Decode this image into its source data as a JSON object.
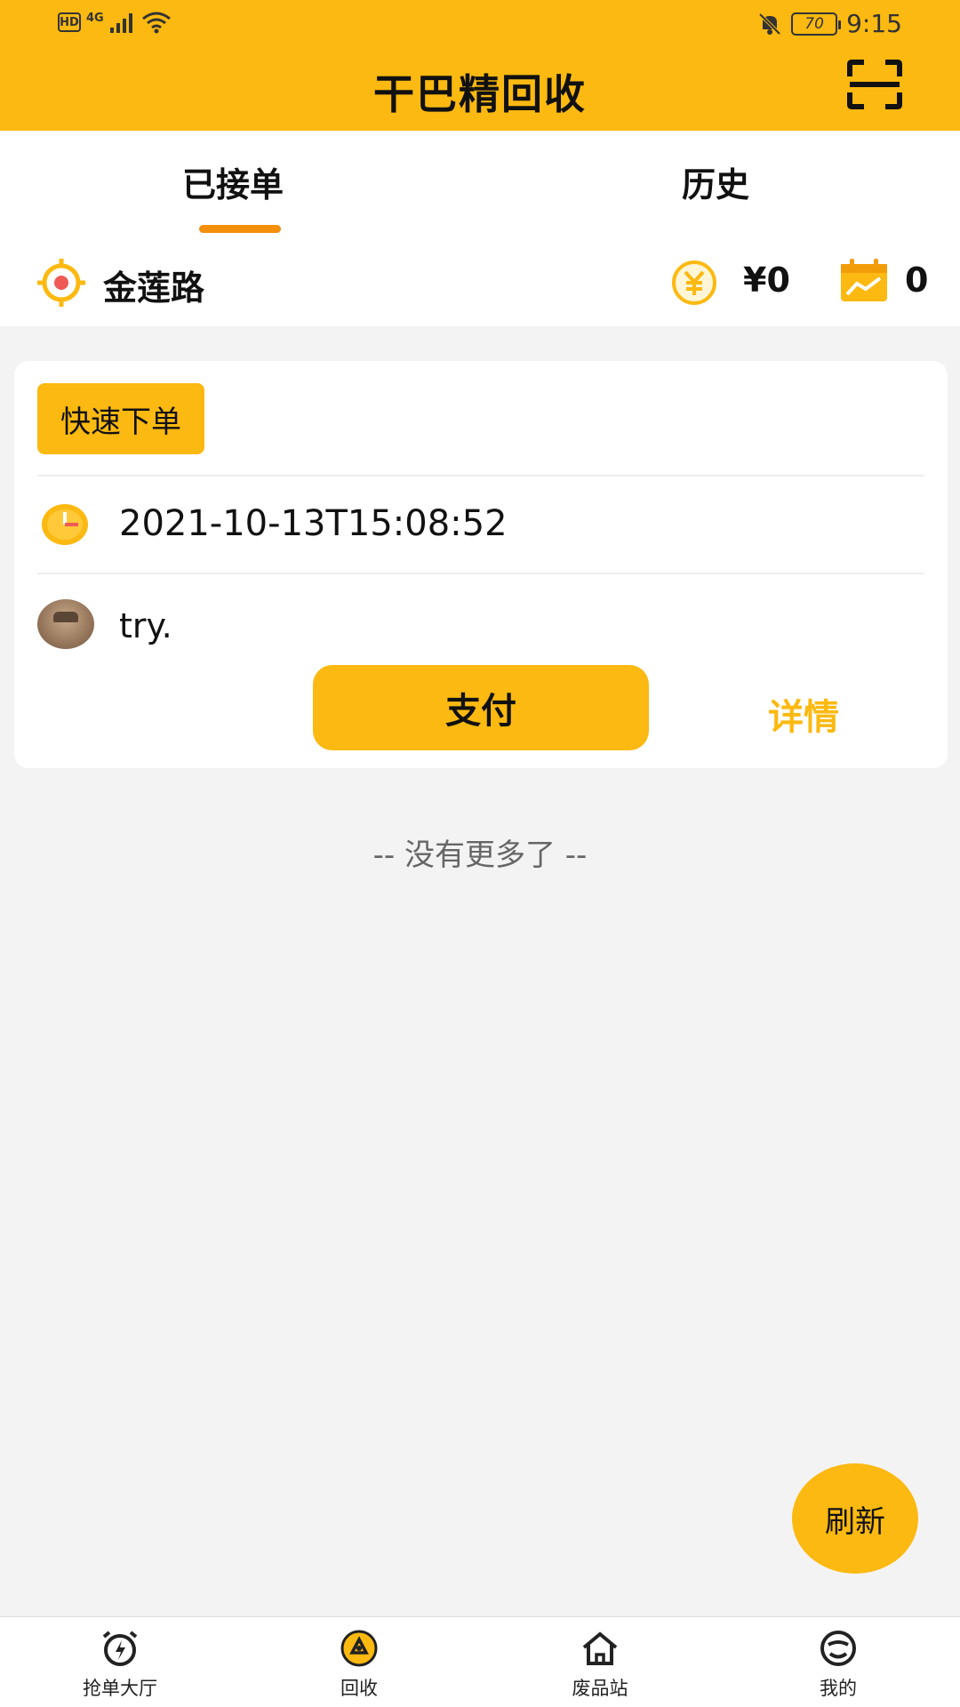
{
  "status_bar": {
    "hd": "HD",
    "network": "4G",
    "battery": "70",
    "time": "9:15"
  },
  "header": {
    "title": "干巴精回收",
    "scan_icon": "scan-icon"
  },
  "tabs": [
    {
      "label": "已接单",
      "active": true
    },
    {
      "label": "历史",
      "active": false
    }
  ],
  "location_bar": {
    "location": "金莲路",
    "money": "¥0",
    "count": "0"
  },
  "order": {
    "tag": "快速下单",
    "time": "2021-10-13T15:08:52",
    "user": "try.",
    "pay_label": "支付",
    "detail_label": "详情"
  },
  "list_end": "-- 没有更多了 --",
  "refresh_label": "刷新",
  "bottom_nav": [
    {
      "label": "抢单大厅",
      "icon": "alarm-clock-icon"
    },
    {
      "label": "回收",
      "icon": "recycle-icon"
    },
    {
      "label": "废品站",
      "icon": "home-icon"
    },
    {
      "label": "我的",
      "icon": "smile-icon"
    }
  ],
  "colors": {
    "primary": "#fbb911",
    "tab_underline": "#f38f0a",
    "background": "#f4f3f4"
  }
}
